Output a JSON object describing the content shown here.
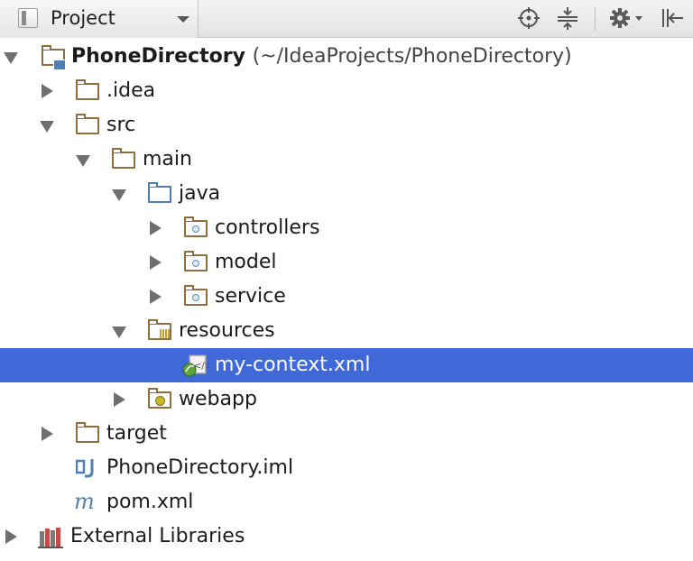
{
  "toolbar": {
    "view_label": "Project",
    "icons": [
      "project-view-icon",
      "locate-icon",
      "collapse-all-icon",
      "gear-icon",
      "hide-icon"
    ]
  },
  "tree": {
    "root": {
      "label": "PhoneDirectory",
      "path": "(~/IdeaProjects/PhoneDirectory)"
    },
    "idea": {
      "label": ".idea"
    },
    "src": {
      "label": "src"
    },
    "main": {
      "label": "main"
    },
    "java": {
      "label": "java"
    },
    "controllers": {
      "label": "controllers"
    },
    "model": {
      "label": "model"
    },
    "service": {
      "label": "service"
    },
    "resources": {
      "label": "resources"
    },
    "context": {
      "label": "my-context.xml",
      "selected": true
    },
    "webapp": {
      "label": "webapp"
    },
    "target": {
      "label": "target"
    },
    "iml": {
      "label": "PhoneDirectory.iml"
    },
    "pom": {
      "label": "pom.xml"
    },
    "libs": {
      "label": "External Libraries"
    }
  },
  "colors": {
    "selection": "#3f69d6",
    "folder": "#8b6f3e",
    "source_folder": "#4d7fb3"
  }
}
